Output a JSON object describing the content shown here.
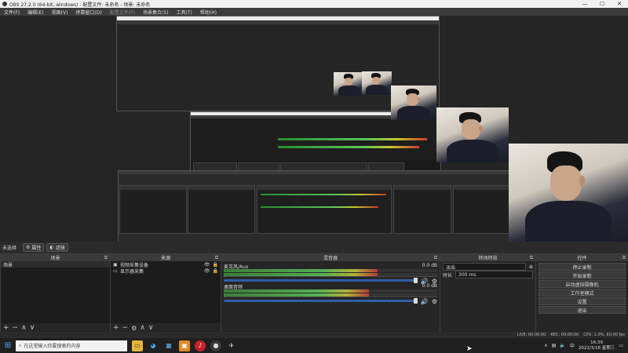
{
  "window": {
    "title": "OBS 27.2.0 (64-bit, windows) - 配置文件: 未命名 - 场景: 未命名",
    "controls": [
      "—",
      "☐",
      "✕"
    ]
  },
  "menu": [
    "文件(F)",
    "编辑(E)",
    "视图(V)",
    "停靠窗口(D)",
    "配置文件(P)",
    "场景集合(S)",
    "工具(T)",
    "帮助(H)"
  ],
  "scene_bar": {
    "current": "未选择",
    "properties_label": "属性",
    "filters_label": "滤镜"
  },
  "scenes": {
    "header": "场景",
    "items": [
      "场景"
    ],
    "footer_icons": [
      "+",
      "−",
      "∧",
      "∨"
    ]
  },
  "sources": {
    "header": "来源",
    "items": [
      {
        "icon": "▣",
        "label": "视频采集设备"
      },
      {
        "icon": "▭",
        "label": "显示器采集"
      }
    ],
    "footer_icons": [
      "+",
      "−",
      "⚙",
      "∧",
      "∨"
    ]
  },
  "mixer": {
    "header": "混音器",
    "channels": [
      {
        "name": "麦克风/Aux",
        "db": "0.0 dB",
        "level": 0.72
      },
      {
        "name": "桌面音频",
        "db": "0.0 dB",
        "level": 0.68
      }
    ]
  },
  "transitions": {
    "header": "转场特效",
    "type": "淡出",
    "duration_label": "时长",
    "duration_value": "300 ms"
  },
  "controls": {
    "header": "控件",
    "buttons": [
      "停止录制",
      "开始录制",
      "启动虚拟摄像机",
      "工作室模式",
      "设置",
      "退出"
    ]
  },
  "status": {
    "live": "LIVE: 00:00:00",
    "rec": "REC: 00:00:00",
    "cpu": "CPU: 1.0%, 60.00 fps"
  },
  "taskbar": {
    "search_placeholder": "在这里输入你要搜索的内容",
    "time": "16:39",
    "date": "2022/3/16 星期三"
  },
  "colors": {
    "accent": "#2f5fa8",
    "meter_green": "#55b055",
    "meter_yellow": "#b3b33a",
    "meter_red": "#b33a3a"
  }
}
